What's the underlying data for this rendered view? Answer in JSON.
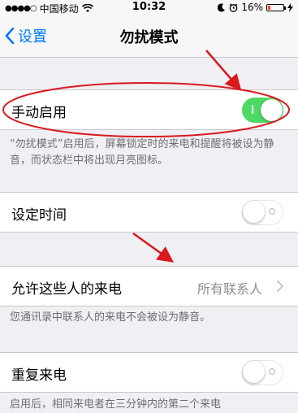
{
  "status_bar": {
    "signal": "●●●●○",
    "carrier": "中国移动",
    "wifi_icon": "wifi-icon",
    "time": "10:32",
    "moon_icon": "moon-icon",
    "alarm_icon": "alarm-icon",
    "battery_percent": "16%",
    "battery_level": 0.16,
    "battery_color": "#ff3b30"
  },
  "nav": {
    "back_label": "设置",
    "title": "勿扰模式",
    "accent": "#007aff"
  },
  "manual": {
    "label": "手动启用",
    "enabled": true,
    "on_color": "#4cd964",
    "footer": "“勿扰模式”启用后，屏幕锁定时的来电和提醒将被设为静音，而状态栏中将出现月亮图标。"
  },
  "scheduled": {
    "label": "设定时间",
    "enabled": false
  },
  "allow_calls": {
    "label": "允许这些人的来电",
    "value": "所有联系人",
    "footer": "您通讯录中联系人的来电不会被设为静音。"
  },
  "repeated_calls": {
    "label": "重复来电",
    "enabled": false,
    "footer": "启用后，相同来电者在三分钟内的第二个来电"
  },
  "annotation_color": "#d9191c"
}
